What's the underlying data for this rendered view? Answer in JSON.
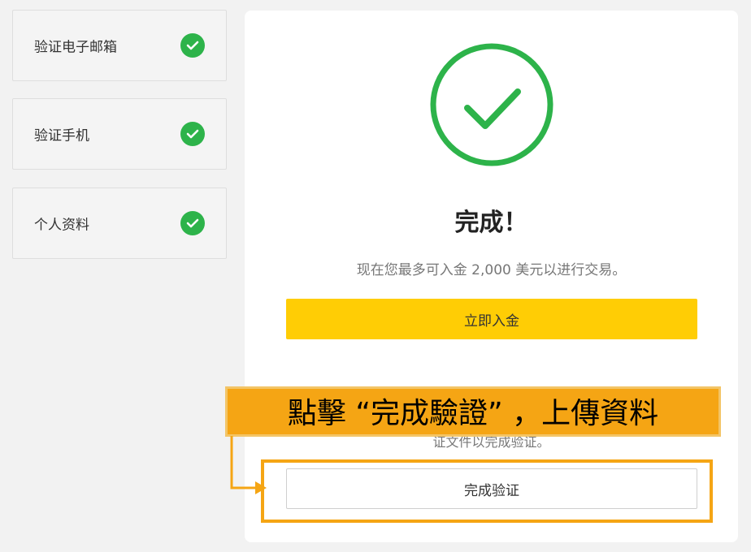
{
  "sidebar": {
    "steps": [
      {
        "label": "验证电子邮箱",
        "status_icon": "check-circle-icon"
      },
      {
        "label": "验证手机",
        "status_icon": "check-circle-icon"
      },
      {
        "label": "个人资料",
        "status_icon": "check-circle-icon"
      }
    ]
  },
  "main": {
    "success_icon": "big-check-circle-icon",
    "title": "完成！",
    "subtitle": "现在您最多可入金 2,000 美元以进行交易。",
    "deposit_button_label": "立即入金",
    "note_text": "证文件以完成验证。",
    "verify_button_label": "完成验证"
  },
  "annotation": {
    "callout_text": "點擊 “完成驗證” ，上傳資料"
  },
  "colors": {
    "success_green": "#2db34a",
    "deposit_yellow": "#ffcd05",
    "annotation_orange": "#f5a514"
  }
}
